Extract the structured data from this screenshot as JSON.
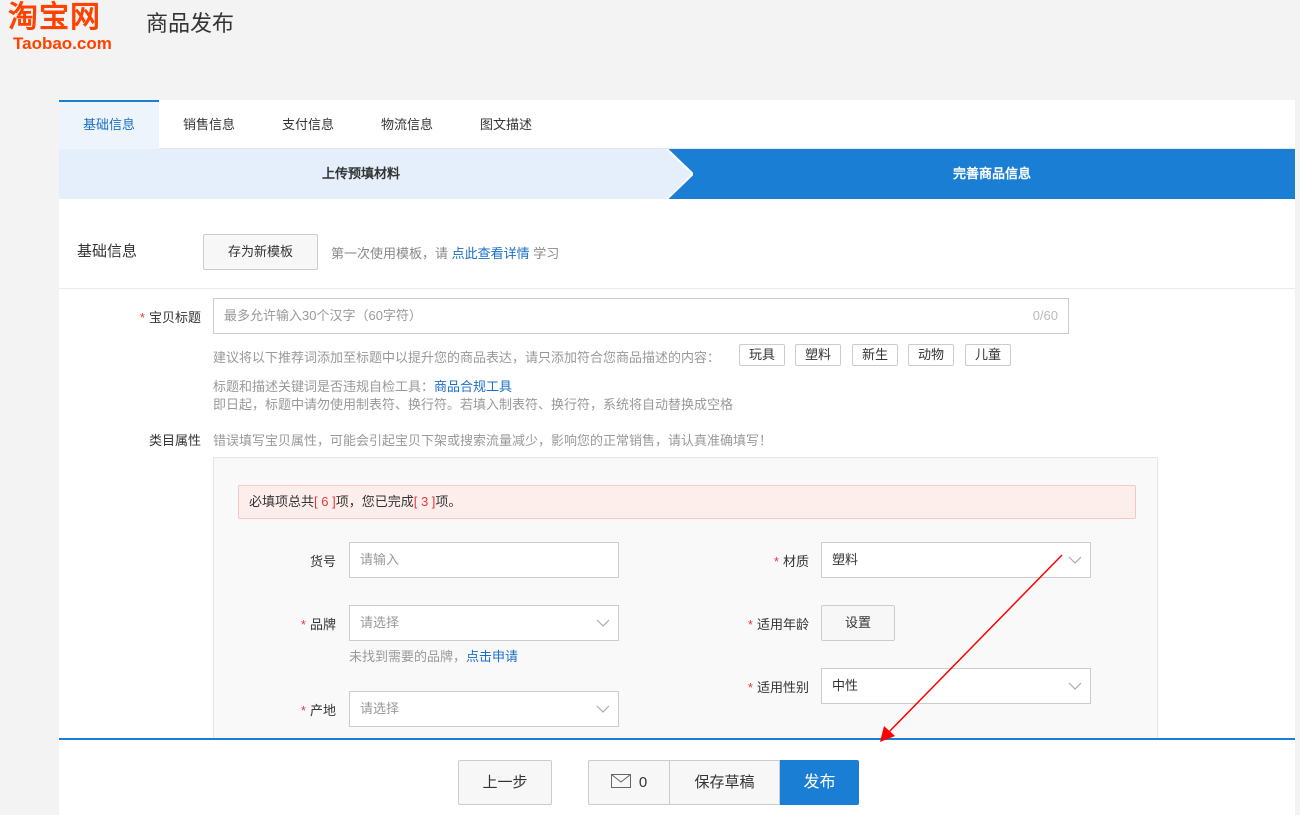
{
  "header": {
    "logo_cn": "淘宝网",
    "logo_en": "Taobao.com",
    "title": "商品发布"
  },
  "tabs": [
    {
      "label": "基础信息",
      "active": true
    },
    {
      "label": "销售信息"
    },
    {
      "label": "支付信息"
    },
    {
      "label": "物流信息"
    },
    {
      "label": "图文描述"
    }
  ],
  "steps": {
    "step1": "上传预填材料",
    "step2": "完善商品信息"
  },
  "template": {
    "label": "基础信息",
    "save_button": "存为新模板",
    "hint_prefix": "第一次使用模板，请",
    "hint_link": "点此查看详情",
    "hint_suffix": "学习"
  },
  "title_field": {
    "label": "宝贝标题",
    "placeholder": "最多允许输入30个汉字（60字符）",
    "counter": "0/60",
    "suggest_hint": "建议将以下推荐词添加至标题中以提升您的商品表达，请只添加符合您商品描述的内容：",
    "tags": [
      "玩具",
      "塑料",
      "新生",
      "动物",
      "儿童"
    ],
    "check_hint": "标题和描述关键词是否违规自检工具：",
    "check_link": "商品合规工具",
    "format_hint": "即日起，标题中请勿使用制表符、换行符。若填入制表符、换行符，系统将自动替换成空格"
  },
  "category": {
    "label": "类目属性",
    "hint": "错误填写宝贝属性，可能会引起宝贝下架或搜索流量减少，影响您的正常销售，请认真准确填写！",
    "notice_prefix": "必填项总共",
    "notice_total": "[ 6 ]",
    "notice_mid": "项，您已完成",
    "notice_done": "[ 3 ]",
    "notice_suffix": "项。",
    "fields": {
      "sku_label": "货号",
      "sku_placeholder": "请输入",
      "brand_label": "品牌",
      "brand_placeholder": "请选择",
      "brand_hint": "未找到需要的品牌，",
      "brand_link": "点击申请",
      "origin_label": "产地",
      "origin_placeholder": "请选择",
      "material_label": "材质",
      "material_value": "塑料",
      "age_label": "适用年龄",
      "age_button": "设置",
      "gender_label": "适用性别",
      "gender_value": "中性"
    }
  },
  "footer": {
    "prev": "上一步",
    "mail_count": "0",
    "save_draft": "保存草稿",
    "publish": "发布"
  },
  "colors": {
    "brand": "#ff4200",
    "accent": "#1a7fd4",
    "required": "#e4393c",
    "annotation_arrow": "#ff0000"
  }
}
